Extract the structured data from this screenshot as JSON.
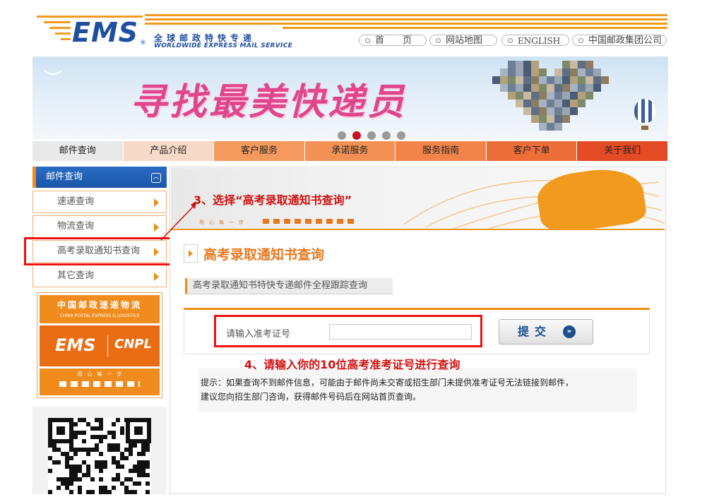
{
  "header": {
    "brand": "EMS",
    "brand_mark": "®",
    "slogan_cn": "全球邮政特快专递",
    "slogan_en": "WORLDWIDE EXPRESS MAIL SERVICE",
    "links": [
      {
        "label": "首　　页"
      },
      {
        "label": "网站地图"
      },
      {
        "label": "ENGLISH"
      },
      {
        "label": "中国邮政集团公司"
      }
    ]
  },
  "banner": {
    "title": "寻找最美快递员",
    "slide_count": 5,
    "active_slide": 2
  },
  "nav": {
    "items": [
      {
        "label": "邮件查询",
        "bg": "#e9e9e9"
      },
      {
        "label": "产品介绍",
        "bg": "#f7d9c7"
      },
      {
        "label": "客户服务",
        "bg": "#f49a5e"
      },
      {
        "label": "承诺服务",
        "bg": "#f39155"
      },
      {
        "label": "服务指南",
        "bg": "#f2844a"
      },
      {
        "label": "客户下单",
        "bg": "#ee6e3a"
      },
      {
        "label": "关于我们",
        "bg": "#e44a24"
      }
    ]
  },
  "sidebar": {
    "header": "邮件查询",
    "items": [
      {
        "label": "速递查询"
      },
      {
        "label": "物流查询"
      },
      {
        "label": "高考录取通知书查询"
      },
      {
        "label": "其它查询"
      }
    ],
    "promo": {
      "top_text": "中国邮政速递物流",
      "top_text_en": "CHINA POSTAL EXPRESS & LOGISTICS",
      "brand_left": "EMS",
      "brand_right": "CNPL",
      "bottom_text": "用　心　每　一　步"
    }
  },
  "main": {
    "banner_caption": "用　心　每　一　步",
    "page_title": "高考录取通知书查询",
    "subtab": "高考录取通知书特快专递邮件全程跟踪查询",
    "form": {
      "label": "请输入准考证号",
      "input_value": "",
      "submit_label": "提交",
      "submit_icon": "»"
    },
    "notice_lines": [
      "提示：如果查询不到邮件信息，可能由于邮件尚未交寄或招生部门未提供准考证号无法链接到邮件，",
      "建议您向招生部门咨询，获得邮件号码后在网站首页查询。"
    ]
  },
  "annotations": {
    "step3": "3、选择“高考录取通知书查询”",
    "step4": "4、请输入你的10位高考准考证号进行查询"
  },
  "colors": {
    "brand_blue": "#1f4fa0",
    "accent_orange": "#f08c14",
    "annotation_red": "#d10f0f"
  }
}
